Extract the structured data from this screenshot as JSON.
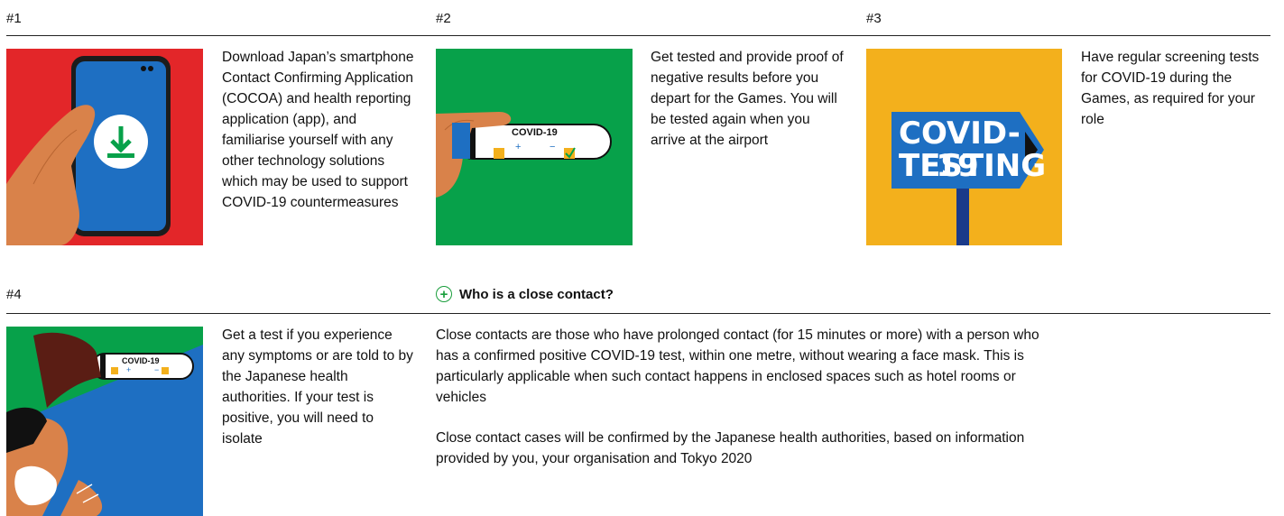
{
  "steps": [
    {
      "number": "#1",
      "text": "Download Japan’s smartphone Contact Confirming Application (COCOA) and health reporting application (app), and familiarise yourself with any other technology solutions which may be used to support COVID-19 countermeasures"
    },
    {
      "number": "#2",
      "text": "Get tested and provide proof of negative results before you depart for the Games. You will be tested again when you arrive at the airport",
      "image_label": "COVID-19",
      "image_plus": "+",
      "image_minus": "−"
    },
    {
      "number": "#3",
      "text": "Have regular screening tests for COVID-19 during the Games, as required for your role",
      "sign_line1": "COVID-19",
      "sign_line2": "TESTING"
    },
    {
      "number": "#4",
      "text": "Get a test if you experience any symptoms or are told to by the Japanese health authorities. If your test is positive, you will need to isolate",
      "image_label": "COVID-19",
      "image_plus": "+",
      "image_minus": "−"
    }
  ],
  "close_contact": {
    "title": "Who is a close contact?",
    "paragraphs": [
      "Close contacts are those who have prolonged contact (for 15 minutes or more) with a person who has a confirmed positive COVID-19 test, within one metre, without wearing a face mask. This is particularly applicable when such contact happens in enclosed spaces such as hotel rooms or vehicles",
      "Close contact cases will be confirmed by the Japanese health authorities, based on information provided by you, your organisation and Tokyo 2020"
    ]
  },
  "colors": {
    "red": "#e32629",
    "green": "#07a14a",
    "yellow": "#f3b01c",
    "blue": "#1e6fc2",
    "skin": "#d9824a"
  }
}
